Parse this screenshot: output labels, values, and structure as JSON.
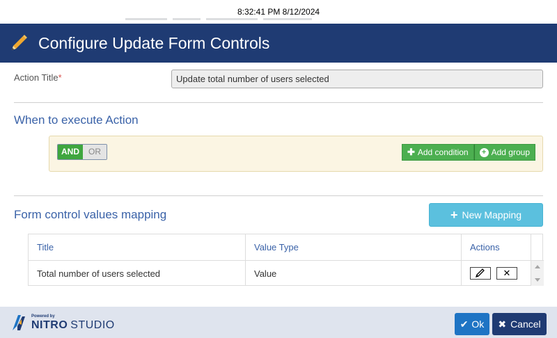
{
  "clock": {
    "text": "8:32:41 PM 8/12/2024"
  },
  "header": {
    "title": "Configure Update Form Controls",
    "color": "#1f3b73",
    "icon": "pencil-icon"
  },
  "action_title": {
    "label": "Action Title",
    "required_mark": "*",
    "value": "Update total number of users selected"
  },
  "when_section": {
    "title": "When to execute Action",
    "toggle": {
      "and_label": "AND",
      "or_label": "OR",
      "selected": "AND"
    },
    "add_condition_label": "Add condition",
    "add_group_label": "Add group"
  },
  "mapping_section": {
    "title": "Form control values mapping",
    "new_mapping_label": "New Mapping",
    "columns": [
      "Title",
      "Value Type",
      "Actions"
    ],
    "rows": [
      {
        "title": "Total number of users selected",
        "value_type": "Value",
        "actions": [
          "edit-icon",
          "delete-icon"
        ]
      }
    ]
  },
  "footer": {
    "logo": {
      "powered_by": "Powered by",
      "brand": "NITRO",
      "product": "STUDIO"
    },
    "ok_label": "Ok",
    "cancel_label": "Cancel"
  },
  "colors": {
    "accent": "#3a62a8",
    "success": "#4caf50",
    "info": "#5bc0de",
    "primary": "#1e74c4"
  }
}
